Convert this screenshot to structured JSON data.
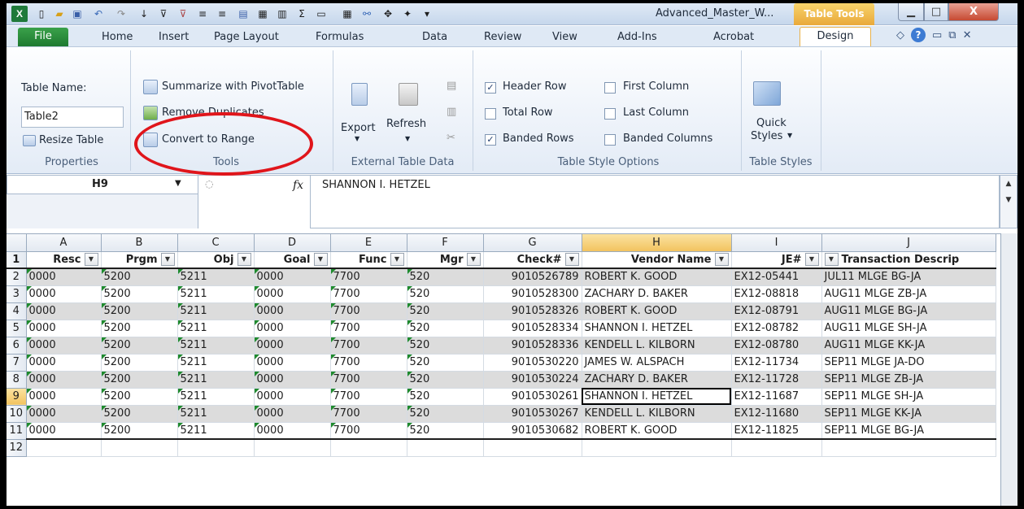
{
  "window": {
    "title": "Advanced_Master_W...",
    "context_tab": "Table Tools"
  },
  "tabs": [
    "File",
    "Home",
    "Insert",
    "Page Layout",
    "Formulas",
    "Data",
    "Review",
    "View",
    "Add-Ins",
    "Acrobat",
    "Design"
  ],
  "ribbon": {
    "properties": {
      "table_name_label": "Table Name:",
      "table_name_value": "Table2",
      "resize": "Resize Table",
      "group": "Properties"
    },
    "tools": {
      "summarize": "Summarize with PivotTable",
      "remove_dup": "Remove Duplicates",
      "convert": "Convert to Range",
      "group": "Tools"
    },
    "external": {
      "export": "Export",
      "refresh": "Refresh",
      "group": "External Table Data"
    },
    "style_options": {
      "header_row": "Header Row",
      "total_row": "Total Row",
      "banded_rows": "Banded Rows",
      "first_column": "First Column",
      "last_column": "Last Column",
      "banded_columns": "Banded Columns",
      "group": "Table Style Options",
      "checked": {
        "header_row": true,
        "total_row": false,
        "banded_rows": true,
        "first_column": false,
        "last_column": false,
        "banded_columns": false
      }
    },
    "styles": {
      "quick_styles_1": "Quick",
      "quick_styles_2": "Styles",
      "group": "Table Styles"
    }
  },
  "formula_bar": {
    "name_box": "H9",
    "fx": "fx",
    "content": "SHANNON I. HETZEL"
  },
  "sheet": {
    "columns": [
      "A",
      "B",
      "C",
      "D",
      "E",
      "F",
      "G",
      "H",
      "I",
      "J"
    ],
    "selected_column": "H",
    "headers": [
      "Resc",
      "Prgm",
      "Obj",
      "Goal",
      "Func",
      "Mgr",
      "Check#",
      "Vendor Name",
      "JE#",
      "Transaction Descrip"
    ],
    "row_numbers": [
      "1",
      "2",
      "3",
      "4",
      "5",
      "6",
      "7",
      "8",
      "9",
      "10",
      "11",
      "12"
    ],
    "selected_row": "9",
    "rows": [
      [
        "0000",
        "5200",
        "5211",
        "0000",
        "7700",
        "520",
        "9010526789",
        "ROBERT K. GOOD",
        "EX12-05441",
        "JUL11 MLGE BG-JA"
      ],
      [
        "0000",
        "5200",
        "5211",
        "0000",
        "7700",
        "520",
        "9010528300",
        "ZACHARY D. BAKER",
        "EX12-08818",
        "AUG11 MLGE ZB-JA"
      ],
      [
        "0000",
        "5200",
        "5211",
        "0000",
        "7700",
        "520",
        "9010528326",
        "ROBERT K. GOOD",
        "EX12-08791",
        "AUG11 MLGE BG-JA"
      ],
      [
        "0000",
        "5200",
        "5211",
        "0000",
        "7700",
        "520",
        "9010528334",
        "SHANNON I. HETZEL",
        "EX12-08782",
        "AUG11 MLGE SH-JA"
      ],
      [
        "0000",
        "5200",
        "5211",
        "0000",
        "7700",
        "520",
        "9010528336",
        "KENDELL L. KILBORN",
        "EX12-08780",
        "AUG11 MLGE KK-JA"
      ],
      [
        "0000",
        "5200",
        "5211",
        "0000",
        "7700",
        "520",
        "9010530220",
        "JAMES W. ALSPACH",
        "EX12-11734",
        "SEP11 MLGE JA-DO"
      ],
      [
        "0000",
        "5200",
        "5211",
        "0000",
        "7700",
        "520",
        "9010530224",
        "ZACHARY D. BAKER",
        "EX12-11728",
        "SEP11 MLGE ZB-JA"
      ],
      [
        "0000",
        "5200",
        "5211",
        "0000",
        "7700",
        "520",
        "9010530261",
        "SHANNON I. HETZEL",
        "EX12-11687",
        "SEP11 MLGE SH-JA"
      ],
      [
        "0000",
        "5200",
        "5211",
        "0000",
        "7700",
        "520",
        "9010530267",
        "KENDELL L. KILBORN",
        "EX12-11680",
        "SEP11 MLGE KK-JA"
      ],
      [
        "0000",
        "5200",
        "5211",
        "0000",
        "7700",
        "520",
        "9010530682",
        "ROBERT K. GOOD",
        "EX12-11825",
        "SEP11 MLGE BG-JA"
      ]
    ]
  },
  "colors": {
    "highlight_circle": "#e0151b",
    "file_tab": "#2a8c3c",
    "table_tools": "#e9a93b"
  }
}
